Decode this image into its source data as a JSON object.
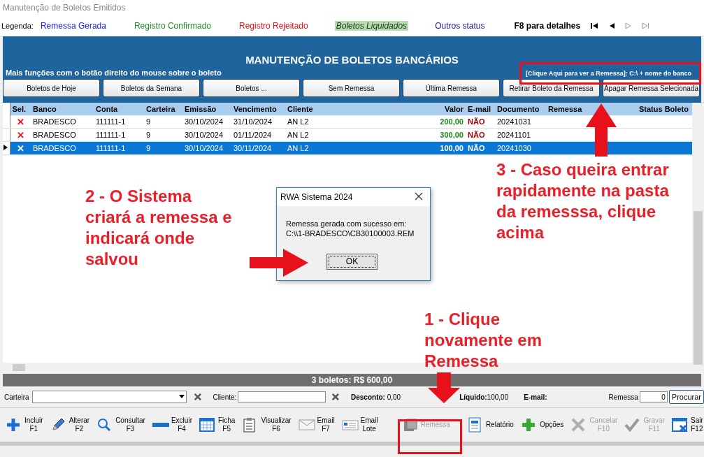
{
  "window": {
    "title": "Manutenção de Boletos Emitidos"
  },
  "legend": {
    "label": "Legenda:",
    "items": [
      {
        "label": "Remessa Gerada",
        "color": "#1a1aff",
        "italic": false
      },
      {
        "label": "Registro Confirmado",
        "color": "#1f8a2a",
        "italic": false
      },
      {
        "label": "Registro Rejeitado",
        "color": "#e8101a",
        "italic": false
      },
      {
        "label": "Boletos Liquidados",
        "color": "#1a3a1a",
        "italic": true
      },
      {
        "label": "Outros status",
        "color": "#1a1a9a",
        "italic": false
      }
    ],
    "hint": "F8 para detalhes"
  },
  "panel": {
    "title": "MANUTENÇÃO DE BOLETOS BANCÁRIOS",
    "subtitle": "Mais funções com o botão direito do mouse sobre o boleto",
    "link": "[Clique Aqui para ver a Remessa]: C:\\ + nome do banco"
  },
  "filter_buttons": [
    "Boletos de Hoje",
    "Boletos da Semana",
    "Boletos ...",
    "Sem Remessa",
    "Última Remessa",
    "Retirar Boleto da Remessa",
    "Apagar Remessa Selecionada"
  ],
  "table": {
    "columns": [
      "Sel.",
      "Banco",
      "Conta",
      "Carteira",
      "Emissão",
      "Vencimento",
      "Cliente",
      "Valor",
      "E-mail",
      "Documento",
      "Remessa",
      "",
      "Status Boleto"
    ],
    "rows": [
      {
        "sel": "✕",
        "banco": "BRADESCO",
        "conta": "111111-1",
        "carteira": "9",
        "emissao": "30/10/2024",
        "vencimento": "31/10/2024",
        "cliente": "AN L2",
        "valor": "200,00",
        "email": "NÃO",
        "documento": "20241031",
        "selected": false
      },
      {
        "sel": "✕",
        "banco": "BRADESCO",
        "conta": "111111-1",
        "carteira": "9",
        "emissao": "30/10/2024",
        "vencimento": "01/11/2024",
        "cliente": "AN L2",
        "valor": "300,00",
        "email": "NÃO",
        "documento": "20241101",
        "selected": false
      },
      {
        "sel": "✕",
        "banco": "BRADESCO",
        "conta": "111111-1",
        "carteira": "9",
        "emissao": "30/10/2024",
        "vencimento": "30/11/2024",
        "cliente": "AN L2",
        "valor": "100,00",
        "email": "NÃO",
        "documento": "20241030",
        "selected": true
      }
    ]
  },
  "summary": "3 boletos: R$ 600,00",
  "filters": {
    "carteira_label": "Carteira",
    "cliente_label": "Cliente:",
    "desconto": "**Desconto:** 0,00",
    "liquido": "**Líquido:**100,00",
    "email_label": "E-mail:",
    "remessa_label": "Remessa",
    "remessa_value": "0",
    "search_button": "Procurar"
  },
  "toolbar": [
    {
      "label": "Incluir",
      "key": "F1",
      "disabled": false
    },
    {
      "label": "Alterar",
      "key": "F2",
      "disabled": false
    },
    {
      "label": "Consultar",
      "key": "F3",
      "disabled": false
    },
    {
      "label": "Excluir",
      "key": "F4",
      "disabled": false
    },
    {
      "label": "Ficha",
      "key": "F5",
      "disabled": false
    },
    {
      "label": "Visualizar",
      "key": "F6",
      "disabled": false
    },
    {
      "label": "Email",
      "key": "F7",
      "disabled": false
    },
    {
      "label": "Email",
      "key": "Lote",
      "disabled": false
    },
    {
      "label": "Remessa",
      "disabled": true
    },
    {
      "label": "Relatório",
      "disabled": false
    },
    {
      "label": "Opções",
      "disabled": false
    },
    {
      "label": "Cancelar",
      "key": "F10",
      "disabled": true
    },
    {
      "label": "Gravar",
      "key": "F11",
      "disabled": true
    },
    {
      "label": "Sair",
      "key": "F12",
      "disabled": false
    }
  ],
  "dialog": {
    "title": "RWA Sistema 2024",
    "message": "Remessa gerada com sucesso em:",
    "path": "C:\\\\1-BRADESCO\\CB30100003.REM",
    "button": "OK"
  },
  "annotations": [
    {
      "text": "2 - O Sistema criará a remessa e indicará onde salvou"
    },
    {
      "text": "3 - Caso queira entrar rapidamente na pasta da remesssa, clique acima"
    },
    {
      "text": "1 - Clique novamente em Remessa"
    }
  ]
}
